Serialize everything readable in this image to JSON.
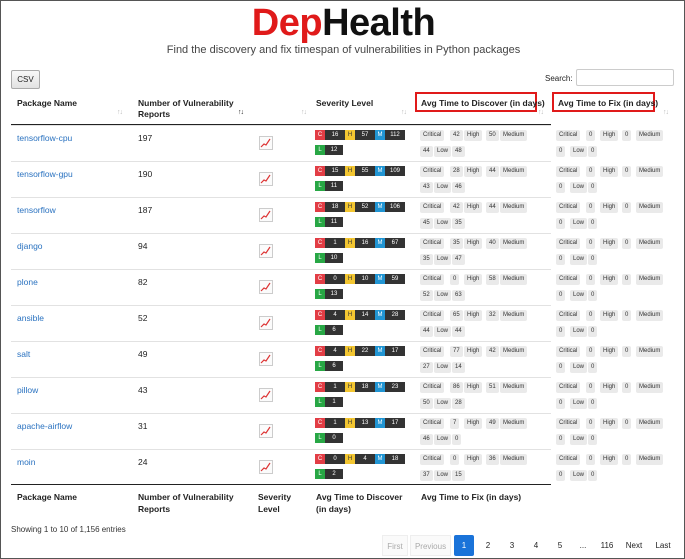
{
  "logo": {
    "part1": "Dep",
    "part2": "Health"
  },
  "subtitle": "Find the discovery and fix timespan of vulnerabilities in Python packages",
  "toolbar": {
    "csv_label": "CSV",
    "search_label": "Search:",
    "search_value": ""
  },
  "columns": {
    "package": "Package Name",
    "reports_1": "Number of Vulnerability",
    "reports_2": "Reports",
    "severity": "Severity Level",
    "discover": "Avg Time to Discover (in days)",
    "fix": "Avg Time to Fix (in days)"
  },
  "footer_columns": {
    "package": "Package Name",
    "reports_1": "Number of Vulnerability",
    "reports_2": "Reports",
    "severity_1": "Severity",
    "severity_2": "Level",
    "discover_1": "Avg Time to Discover",
    "discover_2": "(in days)",
    "fix": "Avg Time to Fix (in days)"
  },
  "labels": {
    "critical": "Critical",
    "high": "High",
    "medium": "Medium",
    "low": "Low",
    "c": "C",
    "h": "H",
    "m": "M",
    "l": "L"
  },
  "rows": [
    {
      "name": "tensorflow-cpu",
      "reports": "197",
      "sev": {
        "c": "16",
        "h": "57",
        "m": "112",
        "l": "12"
      },
      "discover": {
        "critical": "42",
        "high": "50",
        "medium": "44",
        "low": "48"
      },
      "fix": {
        "critical": "0",
        "high": "0",
        "medium": "0",
        "low": "0"
      }
    },
    {
      "name": "tensorflow-gpu",
      "reports": "190",
      "sev": {
        "c": "15",
        "h": "55",
        "m": "109",
        "l": "11"
      },
      "discover": {
        "critical": "28",
        "high": "44",
        "medium": "43",
        "low": "46"
      },
      "fix": {
        "critical": "0",
        "high": "0",
        "medium": "0",
        "low": "0"
      }
    },
    {
      "name": "tensorflow",
      "reports": "187",
      "sev": {
        "c": "18",
        "h": "52",
        "m": "106",
        "l": "11"
      },
      "discover": {
        "critical": "42",
        "high": "44",
        "medium": "45",
        "low": "35"
      },
      "fix": {
        "critical": "0",
        "high": "0",
        "medium": "0",
        "low": "0"
      }
    },
    {
      "name": "django",
      "reports": "94",
      "sev": {
        "c": "1",
        "h": "16",
        "m": "67",
        "l": "10"
      },
      "discover": {
        "critical": "35",
        "high": "40",
        "medium": "35",
        "low": "47"
      },
      "fix": {
        "critical": "0",
        "high": "0",
        "medium": "0",
        "low": "0"
      }
    },
    {
      "name": "plone",
      "reports": "82",
      "sev": {
        "c": "0",
        "h": "10",
        "m": "59",
        "l": "13"
      },
      "discover": {
        "critical": "0",
        "high": "58",
        "medium": "52",
        "low": "63"
      },
      "fix": {
        "critical": "0",
        "high": "0",
        "medium": "0",
        "low": "0"
      }
    },
    {
      "name": "ansible",
      "reports": "52",
      "sev": {
        "c": "4",
        "h": "14",
        "m": "28",
        "l": "6"
      },
      "discover": {
        "critical": "65",
        "high": "32",
        "medium": "44",
        "low": "44"
      },
      "fix": {
        "critical": "0",
        "high": "0",
        "medium": "0",
        "low": "0"
      }
    },
    {
      "name": "salt",
      "reports": "49",
      "sev": {
        "c": "4",
        "h": "22",
        "m": "17",
        "l": "6"
      },
      "discover": {
        "critical": "77",
        "high": "42",
        "medium": "27",
        "low": "14"
      },
      "fix": {
        "critical": "0",
        "high": "0",
        "medium": "0",
        "low": "0"
      }
    },
    {
      "name": "pillow",
      "reports": "43",
      "sev": {
        "c": "1",
        "h": "18",
        "m": "23",
        "l": "1"
      },
      "discover": {
        "critical": "86",
        "high": "51",
        "medium": "50",
        "low": "28"
      },
      "fix": {
        "critical": "0",
        "high": "0",
        "medium": "0",
        "low": "0"
      }
    },
    {
      "name": "apache-airflow",
      "reports": "31",
      "sev": {
        "c": "1",
        "h": "13",
        "m": "17",
        "l": "0"
      },
      "discover": {
        "critical": "7",
        "high": "49",
        "medium": "46",
        "low": "0"
      },
      "fix": {
        "critical": "0",
        "high": "0",
        "medium": "0",
        "low": "0"
      }
    },
    {
      "name": "moin",
      "reports": "24",
      "sev": {
        "c": "0",
        "h": "4",
        "m": "18",
        "l": "2"
      },
      "discover": {
        "critical": "0",
        "high": "36",
        "medium": "37",
        "low": "15"
      },
      "fix": {
        "critical": "0",
        "high": "0",
        "medium": "0",
        "low": "0"
      }
    }
  ],
  "entries_text": "Showing 1 to 10 of 1,156 entries",
  "pagination": {
    "first": "First",
    "previous": "Previous",
    "p1": "1",
    "p2": "2",
    "p3": "3",
    "p4": "4",
    "p5": "5",
    "ellipsis": "...",
    "p116": "116",
    "next": "Next",
    "last": "Last"
  },
  "colors": {
    "brand_red": "#e01a1a",
    "link": "#2a72c0",
    "critical": "#e23d45",
    "high": "#f3c631",
    "medium": "#2195d3",
    "low": "#28a745",
    "page_active": "#1a73d9"
  },
  "icons": {
    "trend": "trend-chart-icon",
    "sort": "sort-arrows-icon"
  }
}
